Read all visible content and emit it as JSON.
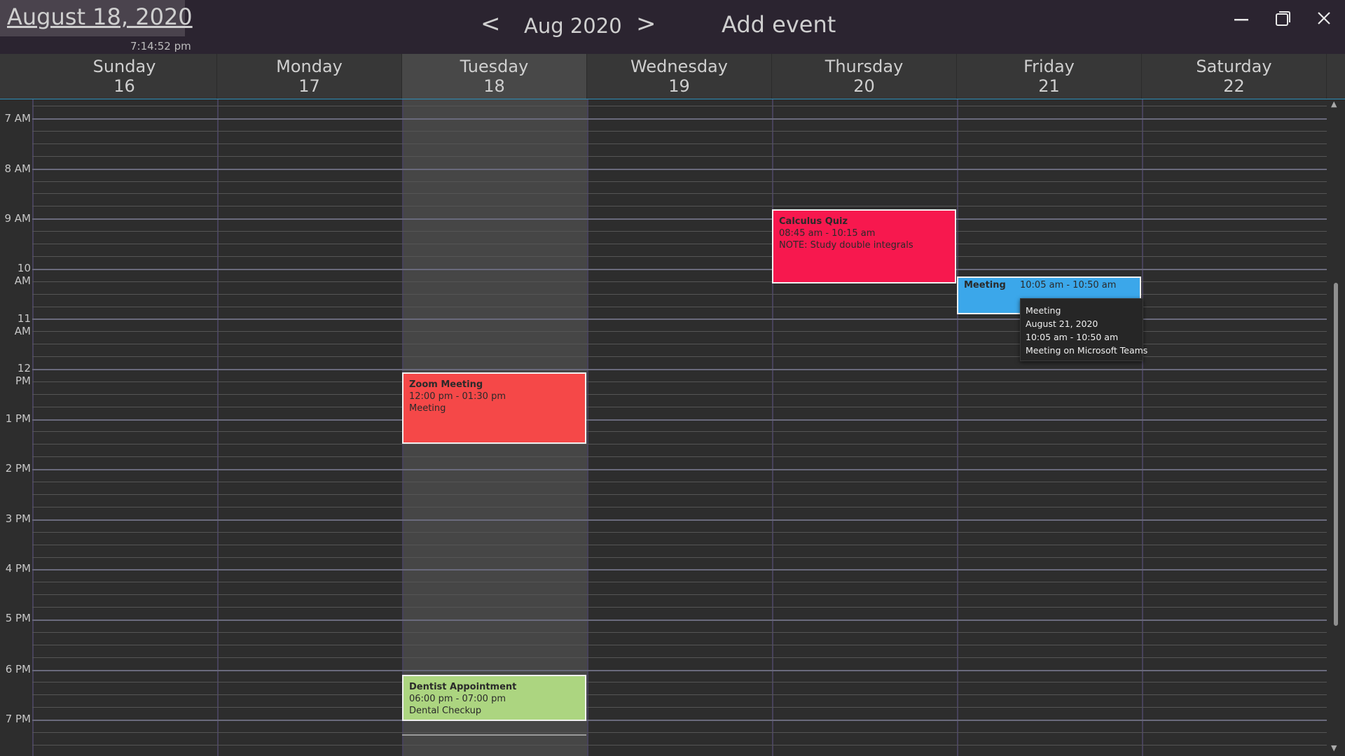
{
  "title_bar": {
    "current_date": "August 18, 2020",
    "clock": "7:14:52 pm",
    "prev_label": "<",
    "month": "Aug 2020",
    "next_label": ">",
    "add_event": "Add event"
  },
  "window_controls": {
    "minimize_icon": "minimize-icon",
    "maximize_icon": "restore-icon",
    "close_icon": "close-icon"
  },
  "days": [
    {
      "name": "Sunday",
      "date": "16"
    },
    {
      "name": "Monday",
      "date": "17"
    },
    {
      "name": "Tuesday",
      "date": "18"
    },
    {
      "name": "Wednesday",
      "date": "19"
    },
    {
      "name": "Thursday",
      "date": "20"
    },
    {
      "name": "Friday",
      "date": "21"
    },
    {
      "name": "Saturday",
      "date": "22"
    }
  ],
  "today_index": 2,
  "time_labels": [
    "7 AM",
    "8 AM",
    "9 AM",
    "10 AM",
    "11 AM",
    "12 PM",
    "1 PM",
    "2 PM",
    "3 PM",
    "4 PM",
    "5 PM",
    "6 PM",
    "7 PM"
  ],
  "events": [
    {
      "title": "Calculus Quiz",
      "time": "08:45 am - 10:15 am",
      "note": "NOTE: Study double integrals",
      "day": "Thursday",
      "color": "#f7184e"
    },
    {
      "title": "Meeting",
      "time": "10:05 am - 10:50 am",
      "note": "",
      "day": "Friday",
      "color": "#3ba7ea"
    },
    {
      "title": "Zoom Meeting",
      "time": "12:00 pm - 01:30 pm",
      "note": "Meeting",
      "day": "Tuesday",
      "color": "#f54848"
    },
    {
      "title": "Dentist Appointment",
      "time": "06:00 pm - 07:00 pm",
      "note": "Dental Checkup",
      "day": "Tuesday",
      "color": "#acd580"
    }
  ],
  "tooltip": {
    "title": "Meeting",
    "date": "August 21, 2020",
    "time": "10:05 am - 10:50 am",
    "description": "Meeting on Microsoft Teams"
  },
  "colors": {
    "titlebar": "#2b2430",
    "background": "#2d2d2d",
    "today_column": "#464646",
    "accent_line": "#2c8eb8"
  }
}
